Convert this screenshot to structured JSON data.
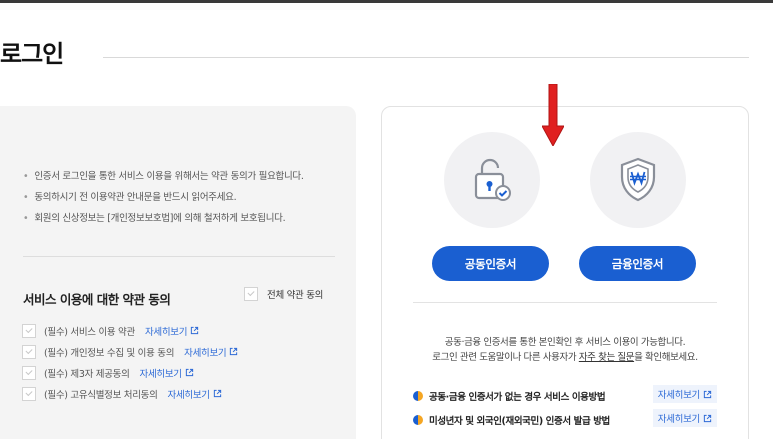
{
  "page": {
    "title": "로그인"
  },
  "notices": [
    "인증서 로그인을 통한 서비스 이용을 위해서는 약관 동의가 필요합니다.",
    "동의하시기 전 이용약관 안내문을 반드시 읽어주세요.",
    "회원의 신상정보는 [개인정보보호법]에 의해 철저하게 보호됩니다."
  ],
  "agreement": {
    "title": "서비스 이용에 대한 약관 동의",
    "all_label": "전체 약관 동의",
    "items": [
      {
        "label": "(필수) 서비스 이용 약관",
        "more": "자세히보기"
      },
      {
        "label": "(필수) 개인정보 수집 및 이용 동의",
        "more": "자세히보기"
      },
      {
        "label": "(필수) 제3자 제공동의",
        "more": "자세히보기"
      },
      {
        "label": "(필수) 고유식별정보 처리동의",
        "more": "자세히보기"
      }
    ]
  },
  "certs": {
    "joint_label": "공동인증서",
    "financial_label": "금융인증서"
  },
  "info": {
    "line1": "공동·금융 인증서를 통한 본인확인 후 서비스 이용이 가능합니다.",
    "line2_prefix": "로그인 관련 도움말이나 다른 사용자가 ",
    "line2_link": "자주 찾는 질문",
    "line2_suffix": "을 확인해보세요."
  },
  "guides": [
    {
      "label": "공동·금융 인증서가 없는 경우 서비스 이용방법",
      "more": "자세히보기"
    },
    {
      "label": "미성년자 및 외국인(재외국민) 인증서 발급 방법",
      "more": "자세히보기"
    }
  ],
  "colors": {
    "primary": "#1a5fd1",
    "link": "#2d6ad6",
    "arrow": "#e02020"
  },
  "icons": {
    "joint": "padlock-check-icon",
    "financial": "shield-won-icon",
    "external": "external-link-icon"
  }
}
